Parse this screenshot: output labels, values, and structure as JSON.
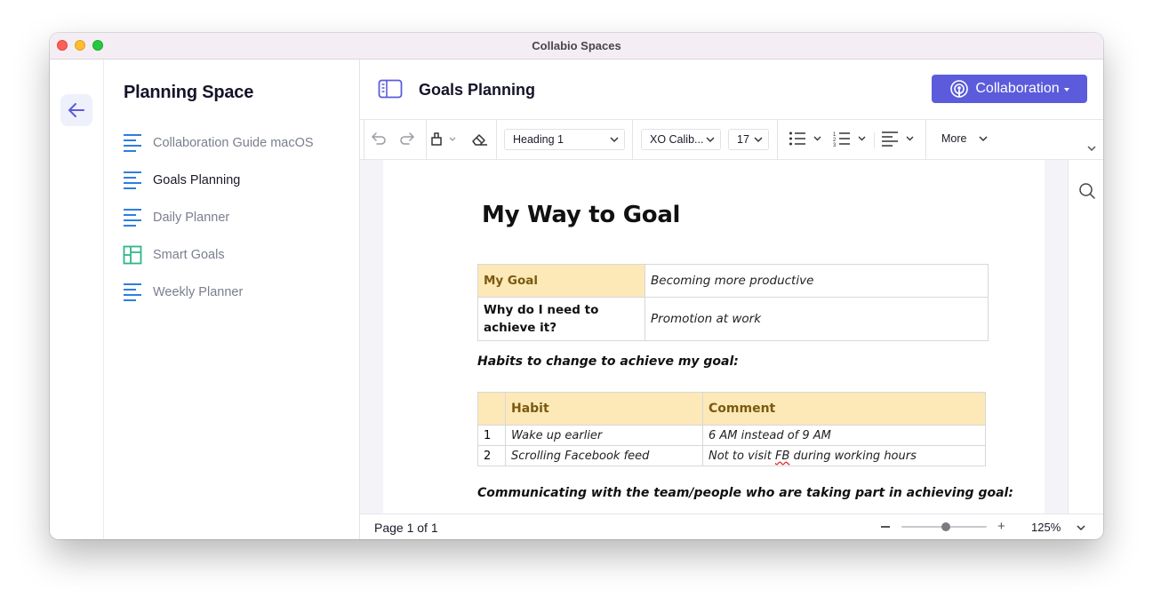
{
  "window": {
    "title": "Collabio Spaces"
  },
  "sidebar": {
    "space_title": "Planning Space",
    "items": [
      {
        "label": "Collaboration Guide macOS",
        "icon": "document-lines-icon"
      },
      {
        "label": "Goals Planning",
        "icon": "document-lines-icon",
        "active": true
      },
      {
        "label": "Daily Planner",
        "icon": "document-lines-icon"
      },
      {
        "label": "Smart Goals",
        "icon": "board-grid-icon"
      },
      {
        "label": "Weekly Planner",
        "icon": "document-lines-icon"
      }
    ]
  },
  "header": {
    "doc_title": "Goals Planning",
    "collab_label": "Collaboration"
  },
  "toolbar": {
    "style_value": "Heading 1",
    "font_value": "XO Calib...",
    "size_value": "17",
    "more_label": "More"
  },
  "document": {
    "heading": "My Way to Goal",
    "goal_table": {
      "row1_key": "My Goal",
      "row1_value": "Becoming more productive",
      "row2_key": "Why do I need to achieve it?",
      "row2_value": "Promotion at work"
    },
    "habits_heading": "Habits to change to achieve my goal:",
    "habits_table": {
      "col_habit": "Habit",
      "col_comment": "Comment",
      "rows": [
        {
          "num": "1",
          "habit": "Wake up earlier",
          "comment": "6 AM instead of 9 AM"
        },
        {
          "num": "2",
          "habit": "Scrolling Facebook feed",
          "comment_before": "Not to visit ",
          "comment_flag": "FB",
          "comment_after": " during working hours"
        }
      ]
    },
    "team_heading": "Communicating with the team/people who are taking part in achieving goal:"
  },
  "status": {
    "page_count": "Page 1 of 1",
    "zoom_level": "125%",
    "zoom_fraction": 0.52
  },
  "colors": {
    "accent": "#5b5bdc",
    "icon_blue": "#2f7ee0",
    "icon_green": "#2fb58a",
    "table_highlight": "#fde9b8"
  }
}
